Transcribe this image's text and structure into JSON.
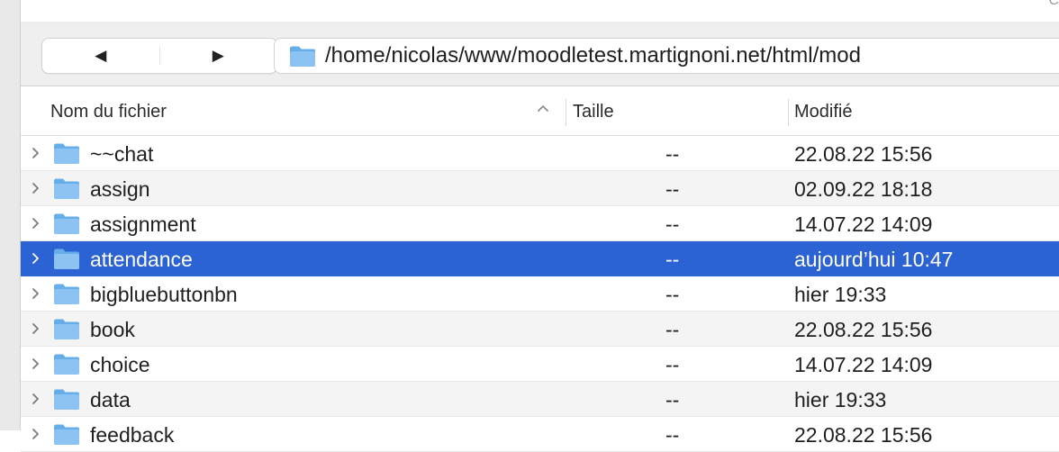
{
  "titlebar": {
    "corner_char": "C"
  },
  "toolbar": {
    "back_glyph": "◀",
    "forward_glyph": "▶",
    "path": "/home/nicolas/www/moodletest.martignoni.net/html/mod"
  },
  "columns": {
    "name": "Nom du fichier",
    "size": "Taille",
    "modified": "Modifié",
    "sort_icon": "chevron-up-icon"
  },
  "colors": {
    "selection": "#2b62d4",
    "folder_fill": "#8cc3f2",
    "folder_tab": "#66aee9"
  },
  "rows": [
    {
      "name": "~~chat",
      "size": "--",
      "modified": "22.08.22 15:56",
      "selected": false
    },
    {
      "name": "assign",
      "size": "--",
      "modified": "02.09.22 18:18",
      "selected": false
    },
    {
      "name": "assignment",
      "size": "--",
      "modified": "14.07.22 14:09",
      "selected": false
    },
    {
      "name": "attendance",
      "size": "--",
      "modified": "aujourd’hui 10:47",
      "selected": true
    },
    {
      "name": "bigbluebuttonbn",
      "size": "--",
      "modified": "hier 19:33",
      "selected": false
    },
    {
      "name": "book",
      "size": "--",
      "modified": "22.08.22 15:56",
      "selected": false
    },
    {
      "name": "choice",
      "size": "--",
      "modified": "14.07.22 14:09",
      "selected": false
    },
    {
      "name": "data",
      "size": "--",
      "modified": "hier 19:33",
      "selected": false
    },
    {
      "name": "feedback",
      "size": "--",
      "modified": "22.08.22 15:56",
      "selected": false
    }
  ]
}
